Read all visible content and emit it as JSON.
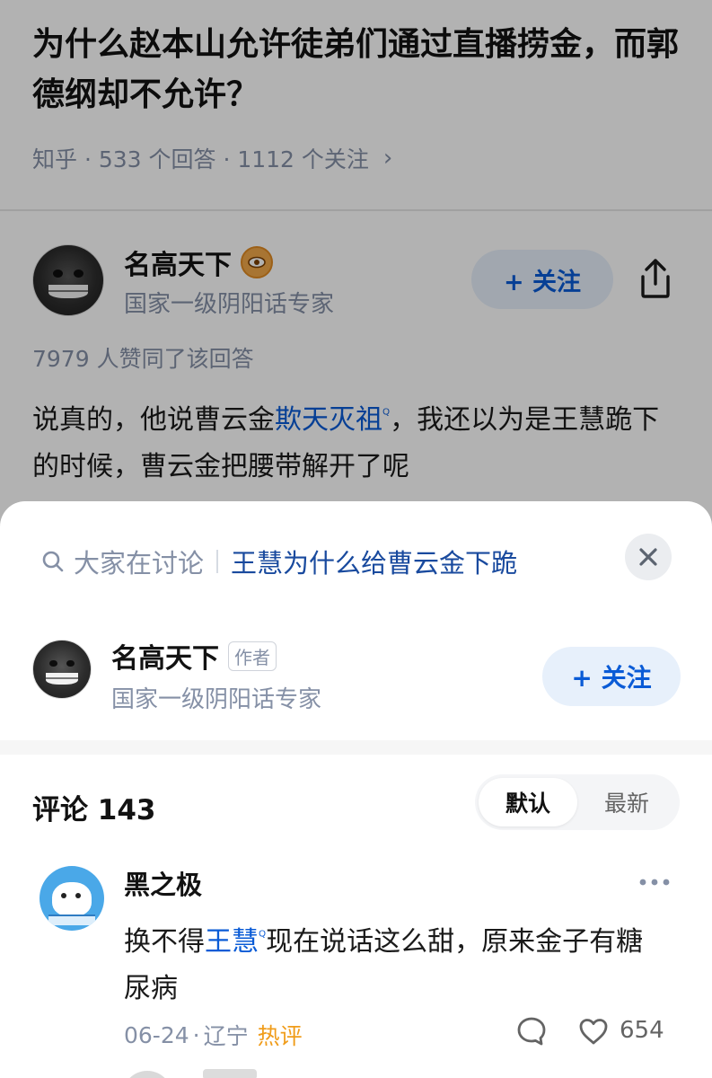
{
  "question": {
    "title": "为什么赵本山允许徒弟们通过直播捞金，而郭德纲却不允许？",
    "meta": "知乎 · 533 个回答 · 1112 个关注"
  },
  "answer": {
    "author_name": "名高天下",
    "author_bio": "国家一级阴阳话专家",
    "follow_label": "+ 关注",
    "likes_text": "7979 人赞同了该回答",
    "text_before": "说真的，他说曹云金",
    "text_link": "欺天灭祖",
    "text_after": "，我还以为是王慧跪下的时候，曹云金把腰带解开了呢"
  },
  "sheet": {
    "discuss_label": "大家在讨论",
    "discuss_topic": "王慧为什么给曹云金下跪",
    "author_name": "名高天下",
    "author_tag": "作者",
    "author_bio": "国家一级阴阳话专家",
    "follow_label": "+ 关注"
  },
  "comments": {
    "header": "评论 143",
    "sort_default": "默认",
    "sort_latest": "最新",
    "items": [
      {
        "name": "黑之极",
        "text_before": "换不得",
        "text_link": "王慧",
        "text_after": "现在说话这么甜，原来金子有糖尿病",
        "date": "06-24",
        "location": "辽宁",
        "tag": "热评",
        "likes": "654"
      }
    ]
  },
  "colors": {
    "accent": "#0a5bd6",
    "muted": "#8590a6",
    "hot": "#f09c1a"
  },
  "icons": [
    "eye-badge-icon",
    "share-icon",
    "search-icon",
    "close-icon",
    "more-icon",
    "reply-icon",
    "heart-icon"
  ]
}
